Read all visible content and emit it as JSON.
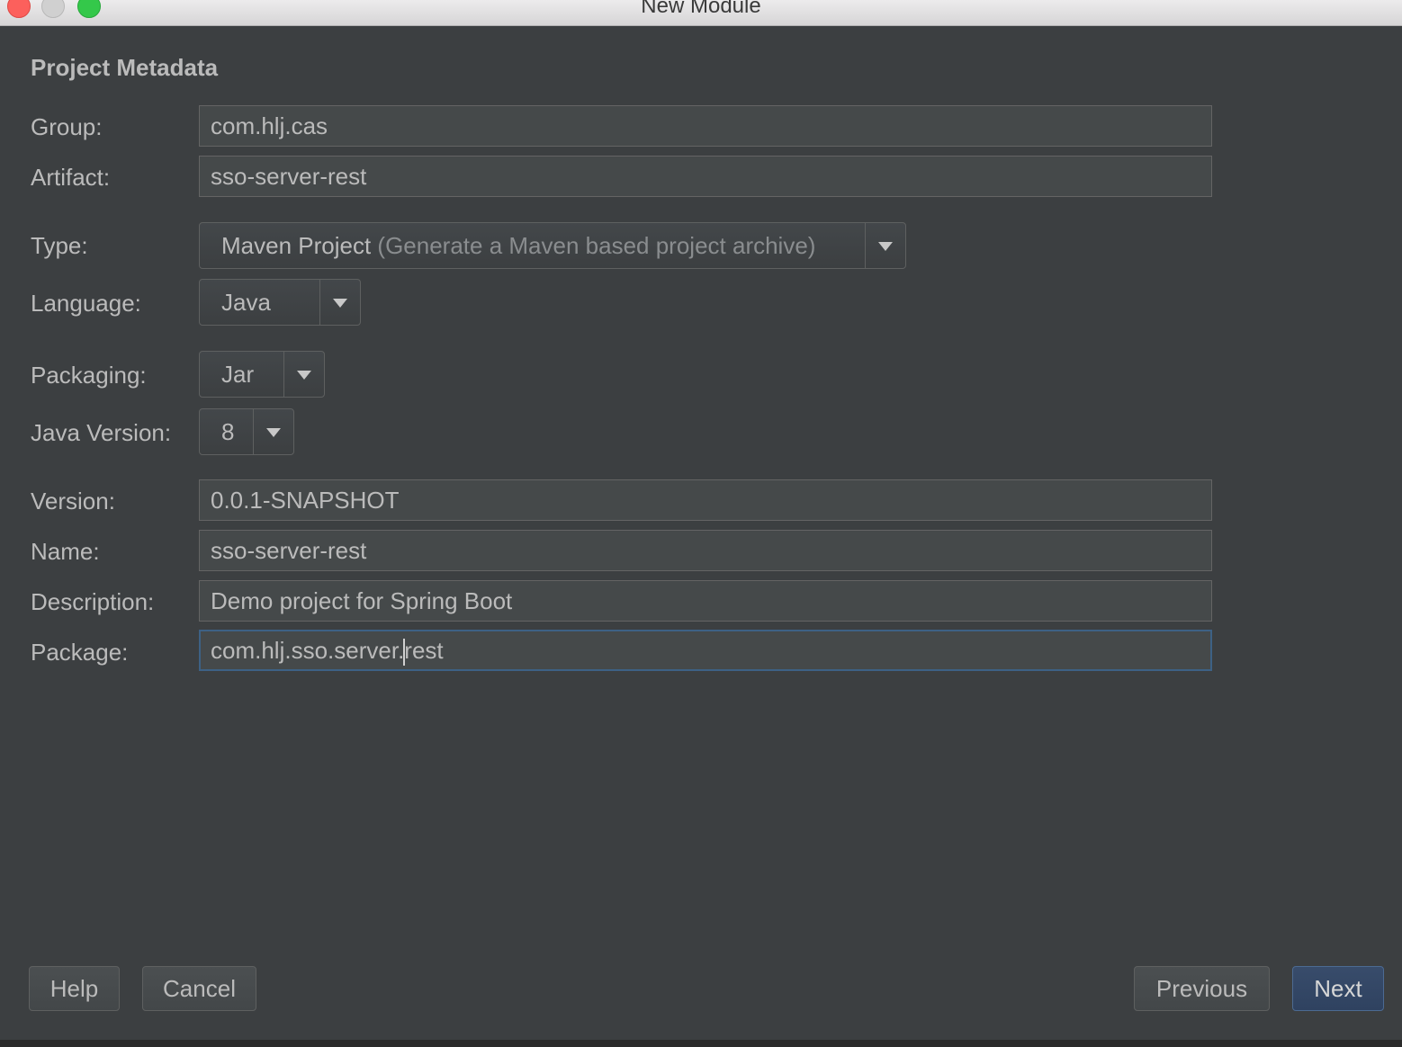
{
  "window": {
    "title": "New Module"
  },
  "section": {
    "title": "Project Metadata"
  },
  "fields": {
    "group": {
      "label": "Group:",
      "value": "com.hlj.cas"
    },
    "artifact": {
      "label": "Artifact:",
      "value": "sso-server-rest"
    },
    "type": {
      "label": "Type:",
      "value": "Maven Project",
      "hint": "(Generate a Maven based project archive)"
    },
    "language": {
      "label": "Language:",
      "value": "Java"
    },
    "packaging": {
      "label": "Packaging:",
      "value": "Jar"
    },
    "java_version": {
      "label": "Java Version:",
      "value": "8"
    },
    "version": {
      "label": "Version:",
      "value": "0.0.1-SNAPSHOT"
    },
    "name": {
      "label": "Name:",
      "value": "sso-server-rest"
    },
    "description": {
      "label": "Description:",
      "value": "Demo project for Spring Boot"
    },
    "package": {
      "label": "Package:",
      "value_before_caret": "com.hlj.sso.server.",
      "value_after_caret": "rest"
    }
  },
  "buttons": {
    "help": "Help",
    "cancel": "Cancel",
    "previous": "Previous",
    "next": "Next"
  },
  "icons": {
    "dropdown": "chevron-down-icon"
  },
  "colors": {
    "background": "#3c3f41",
    "text": "#bbbbbb",
    "field_bg": "#45494a",
    "focus_border": "#3d6185",
    "default_button": "#384c6b"
  }
}
